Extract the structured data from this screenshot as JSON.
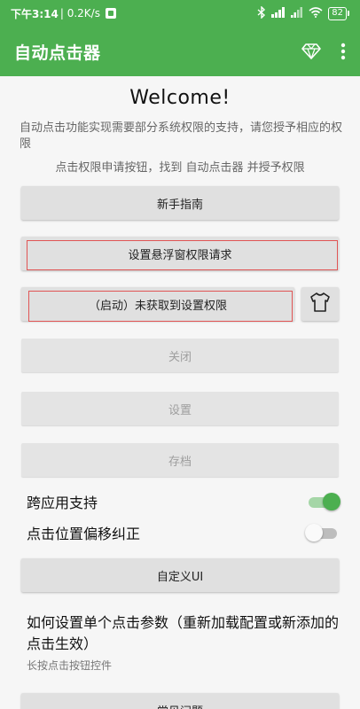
{
  "status_bar": {
    "time": "下午3:14",
    "net_speed": "| 0.2K/s",
    "battery": "82"
  },
  "app_bar": {
    "title": "自动点击器"
  },
  "main": {
    "welcome": "Welcome!",
    "intro": "自动点击功能实现需要部分系统权限的支持，请您授予相应的权限",
    "hint": "点击权限申请按钮，找到 自动点击器 并授予权限",
    "buttons": {
      "guide": "新手指南",
      "overlay_permission": "设置悬浮窗权限请求",
      "start": "（启动）未获取到设置权限",
      "close": "关闭",
      "settings": "设置",
      "archive": "存档",
      "custom_ui": "自定义UI",
      "faq": "常见问题"
    },
    "settings": {
      "cross_app": {
        "label": "跨应用支持",
        "on": true
      },
      "offset_fix": {
        "label": "点击位置偏移纠正",
        "on": false
      }
    },
    "howto": {
      "title": "如何设置单个点击参数（重新加载配置或新添加的点击生效）",
      "subtitle": "长按点击按钮控件"
    }
  },
  "colors": {
    "primary": "#4caf50",
    "highlight_outline": "#e05555"
  }
}
